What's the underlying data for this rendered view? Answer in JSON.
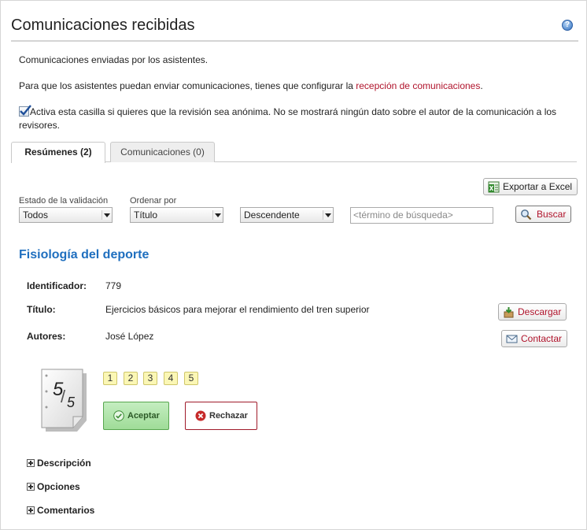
{
  "header": {
    "title": "Comunicaciones recibidas",
    "help_icon": "help-icon",
    "help_glyph": "?"
  },
  "intro": {
    "line1": "Comunicaciones enviadas por los asistentes.",
    "line2_prefix": "Para que los asistentes puedan enviar comunicaciones, tienes que configurar la ",
    "line2_link": "recepción de comunicaciones",
    "line2_suffix": ".",
    "checkbox_label": "Activa esta casilla si quieres que la revisión sea anónima. No se mostrará ningún dato sobre el autor de la comunicación a los revisores.",
    "checkbox_checked": true
  },
  "tabs": [
    {
      "label": "Resúmenes (2)",
      "active": true
    },
    {
      "label": "Comunicaciones (0)",
      "active": false
    }
  ],
  "toolbar": {
    "export_label": "Exportar a Excel",
    "export_icon": "excel-icon"
  },
  "filters": {
    "status_label": "Estado de la validación",
    "status_value": "Todos",
    "order_label": "Ordenar por",
    "order_value": "Título",
    "direction_value": "Descendente",
    "search_placeholder": "<término de búsqueda>",
    "search_button": "Buscar",
    "search_icon": "magnifier-icon"
  },
  "item": {
    "section_title": "Fisiología del deporte",
    "id_label": "Identificador:",
    "id_value": "779",
    "title_label": "Título:",
    "title_value": "Ejercicios básicos para mejorar el rendimiento del tren superior",
    "authors_label": "Autores:",
    "author_name": "José López",
    "download_label": "Descargar",
    "contact_label": "Contactar",
    "score": {
      "numerator": "5",
      "denominator": "5"
    },
    "rating_options": [
      "1",
      "2",
      "3",
      "4",
      "5"
    ],
    "accept_label": "Aceptar",
    "reject_label": "Rechazar",
    "expanders": [
      "Descripción",
      "Opciones",
      "Comentarios"
    ]
  },
  "colors": {
    "link": "#b0132b",
    "section_title": "#1f6fbf",
    "accept_bg": "#a9e0a3",
    "reject_border": "#a01a2a"
  }
}
